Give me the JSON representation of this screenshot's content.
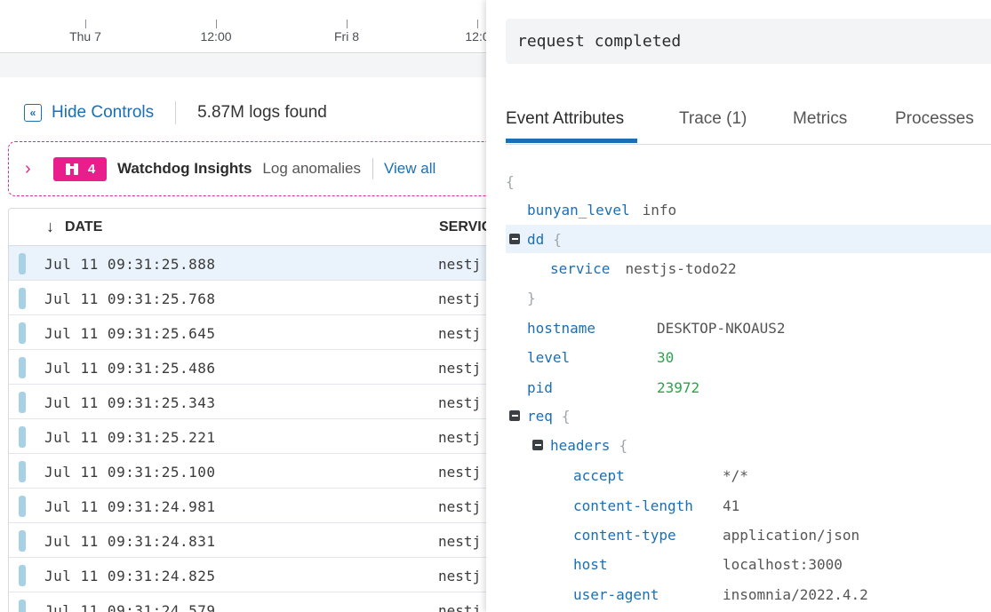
{
  "timeline": {
    "ticks": [
      "Thu 7",
      "12:00",
      "Fri 8",
      "12:0"
    ]
  },
  "controls": {
    "hide_label": "Hide Controls",
    "logs_found": "5.87M logs found"
  },
  "watchdog": {
    "count": "4",
    "title": "Watchdog Insights",
    "subtitle": "Log anomalies",
    "link": "View all"
  },
  "table": {
    "col_date": "DATE",
    "col_service": "SERVIC",
    "rows": [
      {
        "date": "Jul 11 09:31:25.888",
        "service": "nestj"
      },
      {
        "date": "Jul 11 09:31:25.768",
        "service": "nestj"
      },
      {
        "date": "Jul 11 09:31:25.645",
        "service": "nestj"
      },
      {
        "date": "Jul 11 09:31:25.486",
        "service": "nestj"
      },
      {
        "date": "Jul 11 09:31:25.343",
        "service": "nestj"
      },
      {
        "date": "Jul 11 09:31:25.221",
        "service": "nestj"
      },
      {
        "date": "Jul 11 09:31:25.100",
        "service": "nestj"
      },
      {
        "date": "Jul 11 09:31:24.981",
        "service": "nestj"
      },
      {
        "date": "Jul 11 09:31:24.831",
        "service": "nestj"
      },
      {
        "date": "Jul 11 09:31:24.825",
        "service": "nestj"
      },
      {
        "date": "Jul 11 09:31:24.579",
        "service": "nestj"
      }
    ]
  },
  "detail": {
    "message": "request completed",
    "tabs": [
      "Event Attributes",
      "Trace (1)",
      "Metrics",
      "Processes"
    ],
    "json": {
      "open_brace": "{",
      "close_brace": "}",
      "bunyan_level_key": "bunyan_level",
      "bunyan_level_val": "info",
      "dd_key": "dd",
      "service_key": "service",
      "service_val": "nestjs-todo22",
      "hostname_key": "hostname",
      "hostname_val": "DESKTOP-NKOAUS2",
      "level_key": "level",
      "level_val": "30",
      "pid_key": "pid",
      "pid_val": "23972",
      "req_key": "req",
      "headers_key": "headers",
      "accept_key": "accept",
      "accept_val": "*/*",
      "content_length_key": "content-length",
      "content_length_val": "41",
      "content_type_key": "content-type",
      "content_type_val": "application/json",
      "host_key": "host",
      "host_val": "localhost:3000",
      "user_agent_key": "user-agent",
      "user_agent_val": "insomnia/2022.4.2"
    }
  }
}
